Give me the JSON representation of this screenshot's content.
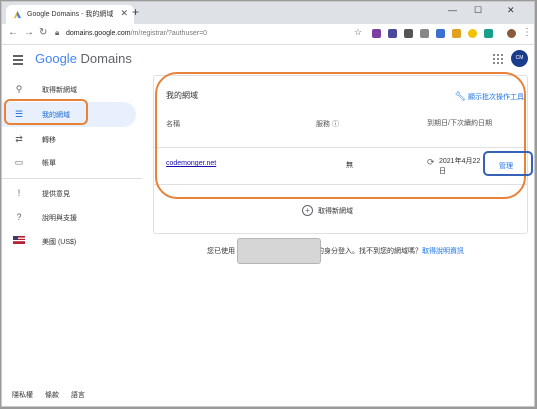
{
  "browser": {
    "tab_title": "Google Domains - 我的網域",
    "url_host": "domains.google.com",
    "url_path": "/m/registrar/?authuser=0",
    "new_tab": "+",
    "minimize": "—",
    "maximize": "☐",
    "close": "✕"
  },
  "app": {
    "logo_google": "Google",
    "logo_domains": "Domains"
  },
  "sidebar": {
    "items": [
      {
        "label": "取得新網域",
        "icon": "search-icon"
      },
      {
        "label": "我的網域",
        "icon": "list-icon"
      },
      {
        "label": "轉移",
        "icon": "transfer-icon"
      },
      {
        "label": "帳單",
        "icon": "credit-card-icon"
      },
      {
        "label": "提供意見",
        "icon": "feedback-icon"
      },
      {
        "label": "說明與支援",
        "icon": "help-icon"
      },
      {
        "label": "美國 (US$)",
        "icon": "us-flag-icon"
      }
    ],
    "footer": [
      "隱私權",
      "條款",
      "語言"
    ]
  },
  "main": {
    "card_title": "我的網域",
    "bulk_action": "顯示批次操作工具",
    "columns": [
      "名稱",
      "服務 ⓘ",
      "到期日/下次續約日期"
    ],
    "rows": [
      {
        "domain": "codemonger.net",
        "service": "無",
        "date_line1": "2021年4月22",
        "date_line2": "日",
        "action": "管理"
      }
    ],
    "get_new_domain": "取得新網域",
    "signed_in_prefix": "您已使用",
    "signed_in_suffix": "的身分登入。找不到您的網域嗎？",
    "help_link": "取得說明資訊"
  },
  "colors": {
    "highlight_orange": "#e8823a",
    "highlight_blue": "#3562b5",
    "accent": "#1a73e8"
  }
}
